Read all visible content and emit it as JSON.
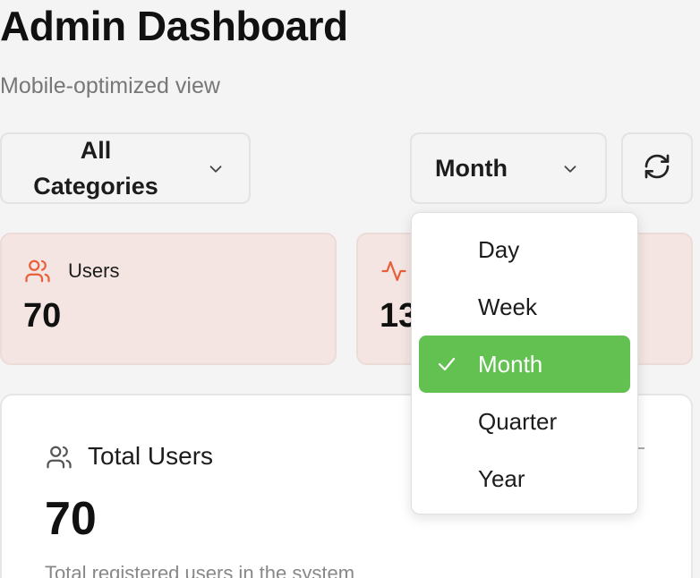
{
  "header": {
    "title": "Admin Dashboard",
    "subtitle": "Mobile-optimized view"
  },
  "filters": {
    "category": {
      "line1": "All",
      "line2": "Categories",
      "icon": "chevron-down-icon"
    },
    "period": {
      "selected": "Month",
      "icon": "chevron-down-icon"
    },
    "refresh": {
      "icon": "refresh-icon"
    }
  },
  "stats": [
    {
      "label": "Users",
      "value": "70",
      "icon": "users-icon",
      "icon_color": "#e8603a"
    },
    {
      "label": "",
      "value": "13",
      "icon": "activity-icon",
      "icon_color": "#e8603a"
    }
  ],
  "card": {
    "label": "Total Users",
    "value": "70",
    "description": "Total registered users in the system",
    "icon": "users-icon"
  },
  "period_dropdown": {
    "options": [
      "Day",
      "Week",
      "Month",
      "Quarter",
      "Year"
    ],
    "selected": "Month",
    "selected_color": "#63c152"
  }
}
